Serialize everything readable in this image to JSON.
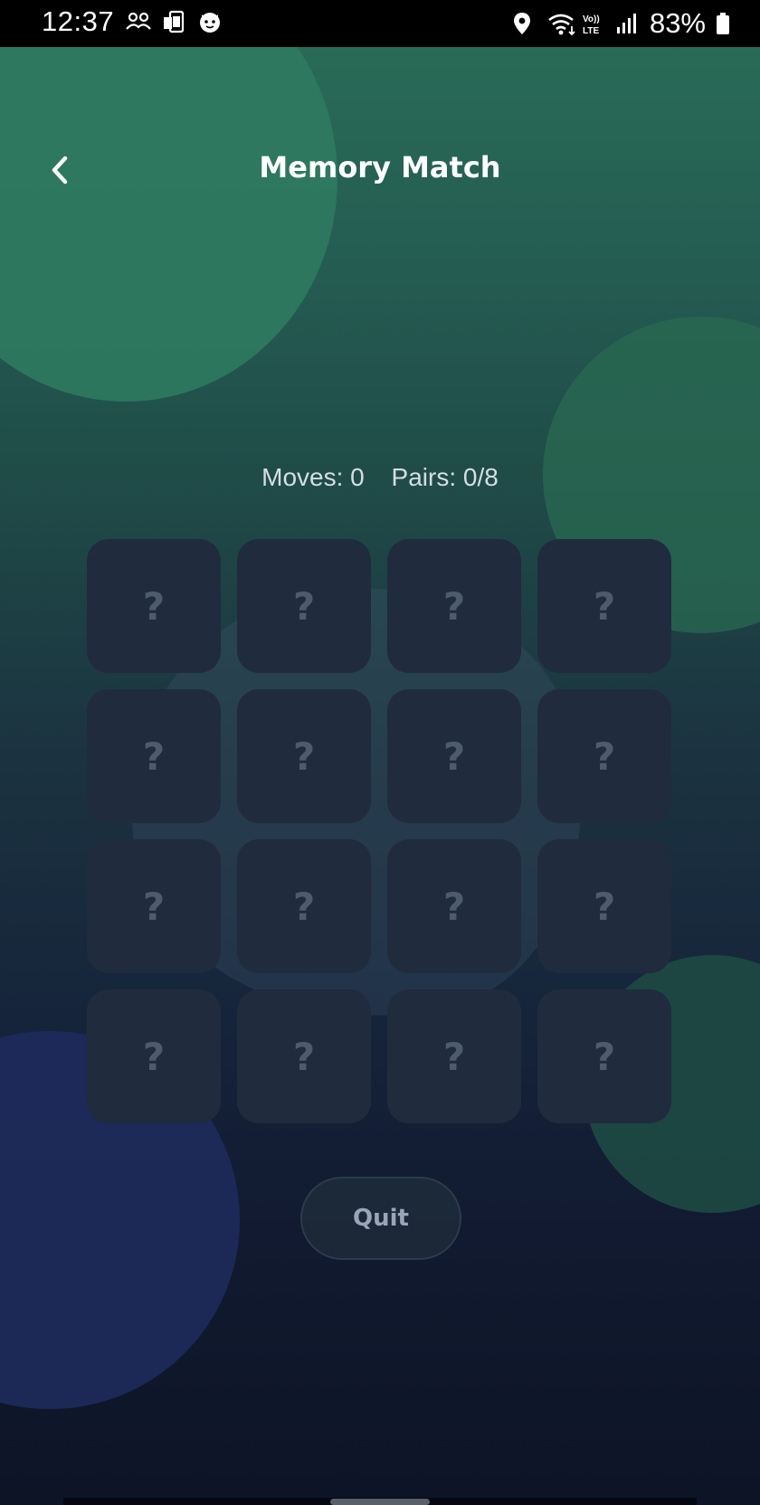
{
  "status_bar": {
    "time": "12:37",
    "battery_percent": "83%",
    "left_icons": [
      "people-icon",
      "device-sync-icon",
      "cat-face-icon"
    ],
    "right_icons": [
      "location-icon",
      "wifi-icon",
      "volte-icon",
      "signal-icon",
      "battery-icon"
    ]
  },
  "header": {
    "title": "Memory Match",
    "back_icon": "chevron-left-icon"
  },
  "stats": {
    "moves_label": "Moves: 0",
    "pairs_label": "Pairs: 0/8"
  },
  "board": {
    "cards": [
      {
        "symbol": "?"
      },
      {
        "symbol": "?"
      },
      {
        "symbol": "?"
      },
      {
        "symbol": "?"
      },
      {
        "symbol": "?"
      },
      {
        "symbol": "?"
      },
      {
        "symbol": "?"
      },
      {
        "symbol": "?"
      },
      {
        "symbol": "?"
      },
      {
        "symbol": "?"
      },
      {
        "symbol": "?"
      },
      {
        "symbol": "?"
      },
      {
        "symbol": "?"
      },
      {
        "symbol": "?"
      },
      {
        "symbol": "?"
      },
      {
        "symbol": "?"
      }
    ]
  },
  "actions": {
    "quit_label": "Quit"
  },
  "colors": {
    "card_back": "#202b3d",
    "card_symbol": "#4e5a6e",
    "title_text": "#ffffff",
    "stats_text": "#d4dde6",
    "quit_text": "#9aa6b8"
  }
}
